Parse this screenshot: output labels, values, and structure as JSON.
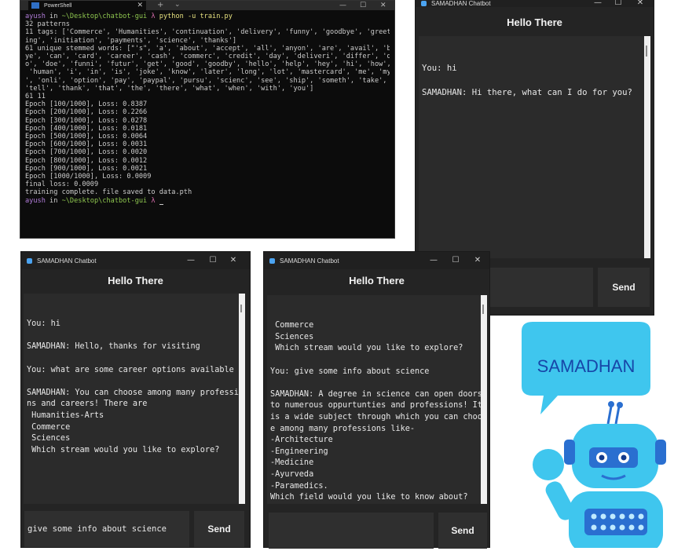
{
  "terminal": {
    "tab_title": "PowerShell",
    "lines": [
      {
        "user": "ayush",
        "in": " in ",
        "path": "~\\Desktop\\chatbot-gui",
        "lambda": " λ ",
        "cmd": "python -u train.py"
      },
      {
        "text": "32 patterns"
      },
      {
        "text": "11 tags: ['Commerce', 'Humanities', 'continuation', 'delivery', 'funny', 'goodbye', 'greet"
      },
      {
        "text": "ing', 'initiation', 'payments', 'science', 'thanks']"
      },
      {
        "text": "61 unique stemmed words: [\"'s\", 'a', 'about', 'accept', 'all', 'anyon', 'are', 'avail', 'b"
      },
      {
        "text": "ye', 'can', 'card', 'career', 'cash', 'commerc', 'credit', 'day', 'deliveri', 'differ', 'd"
      },
      {
        "text": "o', 'doe', 'funni', 'futur', 'get', 'good', 'goodby', 'hello', 'help', 'hey', 'hi', 'how',"
      },
      {
        "text": " 'human', 'i', 'in', 'is', 'joke', 'know', 'later', 'long', 'lot', 'mastercard', 'me', 'my"
      },
      {
        "text": "', 'onli', 'option', 'pay', 'paypal', 'pursu', 'scienc', 'see', 'ship', 'someth', 'take',"
      },
      {
        "text": "'tell', 'thank', 'that', 'the', 'there', 'what', 'when', 'with', 'you']"
      },
      {
        "text": "61 11"
      },
      {
        "text": "Epoch [100/1000], Loss: 0.8387"
      },
      {
        "text": "Epoch [200/1000], Loss: 0.2266"
      },
      {
        "text": "Epoch [300/1000], Loss: 0.0278"
      },
      {
        "text": "Epoch [400/1000], Loss: 0.0181"
      },
      {
        "text": "Epoch [500/1000], Loss: 0.0064"
      },
      {
        "text": "Epoch [600/1000], Loss: 0.0031"
      },
      {
        "text": "Epoch [700/1000], Loss: 0.0020"
      },
      {
        "text": "Epoch [800/1000], Loss: 0.0012"
      },
      {
        "text": "Epoch [900/1000], Loss: 0.0021"
      },
      {
        "text": "Epoch [1000/1000], Loss: 0.0009"
      },
      {
        "text": "final loss: 0.0009"
      },
      {
        "text": "training complete. file saved to data.pth"
      },
      {
        "user": "ayush",
        "in": " in ",
        "path": "~\\Desktop\\chatbot-gui",
        "lambda": " λ ",
        "cmd": ""
      }
    ]
  },
  "windows": [
    {
      "title": "SAMADHAN Chatbot",
      "header": "Hello There",
      "lines": [
        "You: hi",
        "",
        "SAMADHAN: Hi there, what can I do for you?"
      ],
      "input_value": "",
      "send_label": "Send"
    },
    {
      "title": "SAMADHAN Chatbot",
      "header": "Hello There",
      "lines": [
        "You: hi",
        "",
        "SAMADHAN: Hello, thanks for visiting",
        "",
        "You: what are some career options available",
        "",
        "SAMADHAN: You can choose among many professio",
        "ns and careers! There are",
        " Humanities-Arts",
        " Commerce",
        " Sciences",
        " Which stream would you like to explore?"
      ],
      "input_value": "give some info about science",
      "send_label": "Send"
    },
    {
      "title": "SAMADHAN Chatbot",
      "header": "Hello There",
      "lines": [
        " Commerce",
        " Sciences",
        " Which stream would you like to explore?",
        "",
        "You: give some info about science",
        "",
        "SAMADHAN: A degree in science can open doors",
        "to numerous oppurtunties and professions! It",
        "is a wide subject through which you can choos",
        "e among many professions like-",
        "-Architecture",
        "-Engineering",
        "-Medicine",
        "-Ayurveda",
        "-Paramedics.",
        "Which field would you like to know about?"
      ],
      "input_value": "",
      "send_label": "Send"
    }
  ],
  "robot": {
    "speech_label": "SAMADHAN"
  },
  "colors": {
    "robot_body": "#3fc6ee",
    "speech_bubble": "#3fc6ee",
    "robot_label": "#1746a8"
  }
}
